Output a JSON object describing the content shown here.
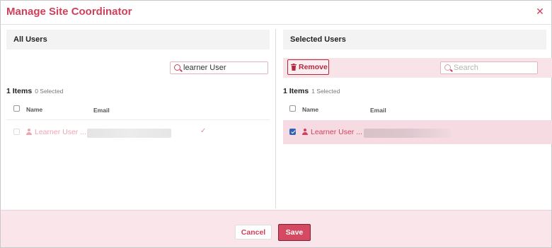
{
  "dialog": {
    "title": "Manage Site Coordinator"
  },
  "left_pane": {
    "heading": "All Users",
    "search": {
      "value": "learner User",
      "placeholder": ""
    },
    "count_label": "1 Items",
    "selected_label": "0 Selected",
    "columns": {
      "name": "Name",
      "email": "Email"
    },
    "rows": [
      {
        "name": "Learner User ...",
        "email_redacted": true,
        "already_selected": true
      }
    ]
  },
  "right_pane": {
    "heading": "Selected Users",
    "remove_label": "Remove",
    "search": {
      "value": "",
      "placeholder": "Search"
    },
    "count_label": "1 Items",
    "selected_label": "1 Selected",
    "columns": {
      "name": "Name",
      "email": "Email"
    },
    "rows": [
      {
        "name": "Learner User ...",
        "email_redacted": true,
        "checked": true
      }
    ]
  },
  "footer": {
    "cancel_label": "Cancel",
    "save_label": "Save"
  },
  "icons": {
    "close": "close-icon",
    "search": "search-icon",
    "trash": "trash-icon",
    "user": "user-icon",
    "check": "check-icon"
  },
  "colors": {
    "accent": "#d0405b",
    "save_bg": "#d34a62",
    "save_border": "#8c1c30",
    "remove_border": "#b4283f",
    "selected_row_bg": "#f6dce2",
    "footer_bg": "#f9e5ea",
    "checkbox_checked": "#2e63b6"
  }
}
